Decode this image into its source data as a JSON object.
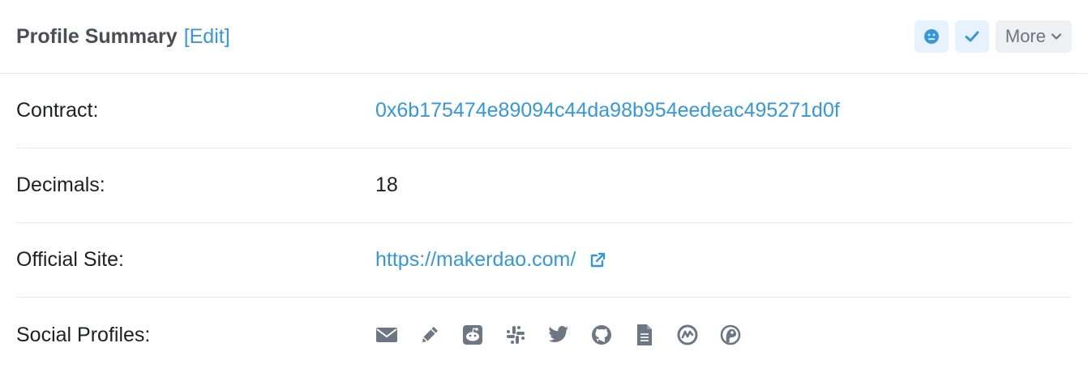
{
  "header": {
    "title": "Profile Summary",
    "edit_label": "[Edit]",
    "more_label": "More"
  },
  "rows": [
    {
      "label": "Contract:",
      "value": "0x6b175474e89094c44da98b954eedeac495271d0f"
    },
    {
      "label": "Decimals:",
      "value": "18"
    },
    {
      "label": "Official Site:",
      "value": "https://makerdao.com/"
    },
    {
      "label": "Social Profiles:"
    }
  ],
  "social_icons": [
    "email-icon",
    "pencil-icon",
    "reddit-icon",
    "slack-icon",
    "twitter-icon",
    "github-icon",
    "document-icon",
    "coinmarketcap-icon",
    "coingecko-icon"
  ],
  "colors": {
    "link": "#3498db",
    "icon": "#6c7783",
    "border": "#e7eaf3",
    "button_bg": "#e8f2fc"
  }
}
